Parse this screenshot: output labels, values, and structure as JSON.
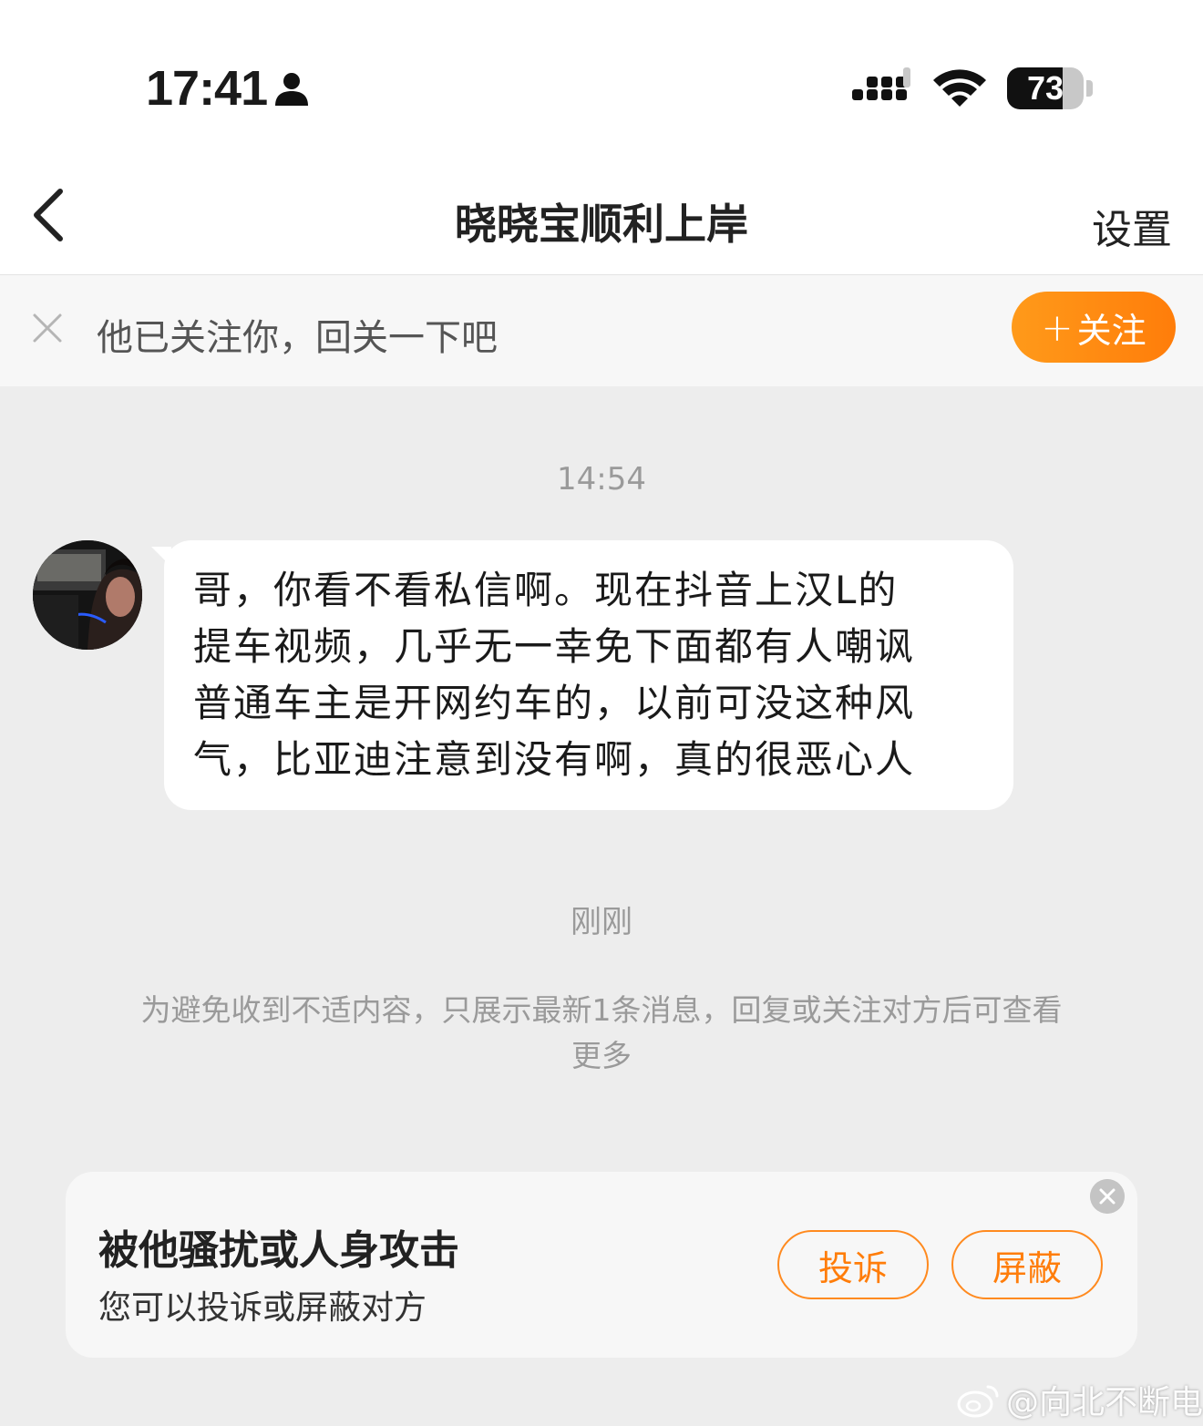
{
  "status_bar": {
    "time": "17:41",
    "battery_level": "73",
    "icons": [
      "person-icon",
      "signal-icon",
      "wifi-icon",
      "battery-icon"
    ]
  },
  "nav": {
    "back_icon": "chevron-left-icon",
    "title": "晓晓宝顺利上岸",
    "settings_label": "设置"
  },
  "follow_banner": {
    "close_icon": "close-icon",
    "text": "他已关注你，回关一下吧",
    "button_plus": "+",
    "button_label": "关注",
    "accent_color": "#ff8a1f"
  },
  "chat": {
    "timestamp_1": "14:54",
    "message_lines": [
      "哥，你看不看私信啊。现在抖音上汉L的",
      "提车视频，几乎无一幸免下面都有人嘲讽",
      "普通车主是开网约车的，以前可没这种风",
      "气，比亚迪注意到没有啊，真的很恶心人"
    ],
    "timestamp_2": "刚刚",
    "notice_lines": [
      "为避免收到不适内容，只展示最新1条消息，回复或关注对方后可查看",
      "更多"
    ]
  },
  "report_card": {
    "title": "被他骚扰或人身攻击",
    "subtitle": "您可以投诉或屏蔽对方",
    "complain_label": "投诉",
    "block_label": "屏蔽",
    "close_icon": "close-circle-icon"
  },
  "watermark": {
    "text": "@向北不断电",
    "logo": "weibo-logo"
  }
}
